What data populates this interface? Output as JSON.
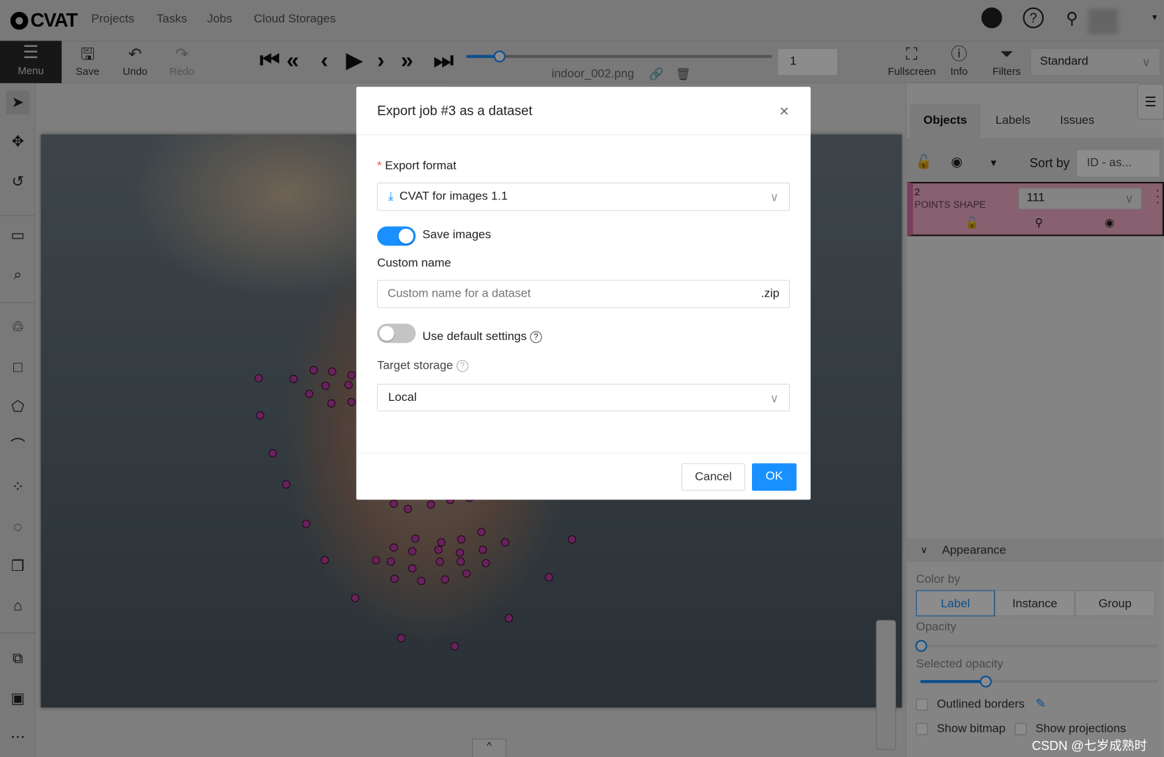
{
  "header": {
    "logo": "CVAT",
    "nav": [
      "Projects",
      "Tasks",
      "Jobs",
      "Cloud Storages"
    ]
  },
  "toolbar": {
    "menu": "Menu",
    "save": "Save",
    "undo": "Undo",
    "redo": "Redo",
    "filename": "indoor_002.png",
    "frame": "1",
    "frame_progress": 0.11,
    "fullscreen": "Fullscreen",
    "info": "Info",
    "filters": "Filters",
    "workspace": "Standard"
  },
  "sidebar": {
    "tools": [
      "cursor-icon",
      "move-icon",
      "rotate-icon",
      "fit-image-icon",
      "zoom-region-icon",
      "ai-tools-icon",
      "rectangle-icon",
      "polygon-icon",
      "polyline-icon",
      "points-icon",
      "ellipse-icon",
      "cuboid-icon",
      "tag-icon",
      "merge-icon",
      "group-icon",
      "more-icon"
    ]
  },
  "right_panel": {
    "tabs": [
      "Objects",
      "Labels",
      "Issues"
    ],
    "active_tab": "Objects",
    "sort_label": "Sort by",
    "sort_value": "ID - as...",
    "object": {
      "id": "2",
      "type": "POINTS SHAPE",
      "label": "111",
      "color": "#e070a8"
    },
    "appearance": {
      "title": "Appearance",
      "color_by": "Color by",
      "options": [
        "Label",
        "Instance",
        "Group"
      ],
      "selected": "Label",
      "opacity": "Opacity",
      "opacity_value": 0,
      "selected_opacity": "Selected opacity",
      "selected_opacity_value": 0.3,
      "outlined_borders": "Outlined borders",
      "show_bitmap": "Show bitmap",
      "show_projections": "Show projections"
    }
  },
  "modal": {
    "title": "Export job #3 as a dataset",
    "export_format_label": "Export format",
    "export_format_value": "CVAT for images 1.1",
    "save_images_label": "Save images",
    "save_images": true,
    "custom_name_label": "Custom name",
    "custom_name_placeholder": "Custom name for a dataset",
    "custom_name_suffix": ".zip",
    "use_default_label": "Use default settings",
    "use_default": false,
    "target_storage_label": "Target storage",
    "target_storage_value": "Local",
    "cancel": "Cancel",
    "ok": "OK"
  },
  "watermark": "CSDN @七岁成熟时",
  "colors": {
    "primary": "#1890ff",
    "required": "#ff4d4f"
  }
}
